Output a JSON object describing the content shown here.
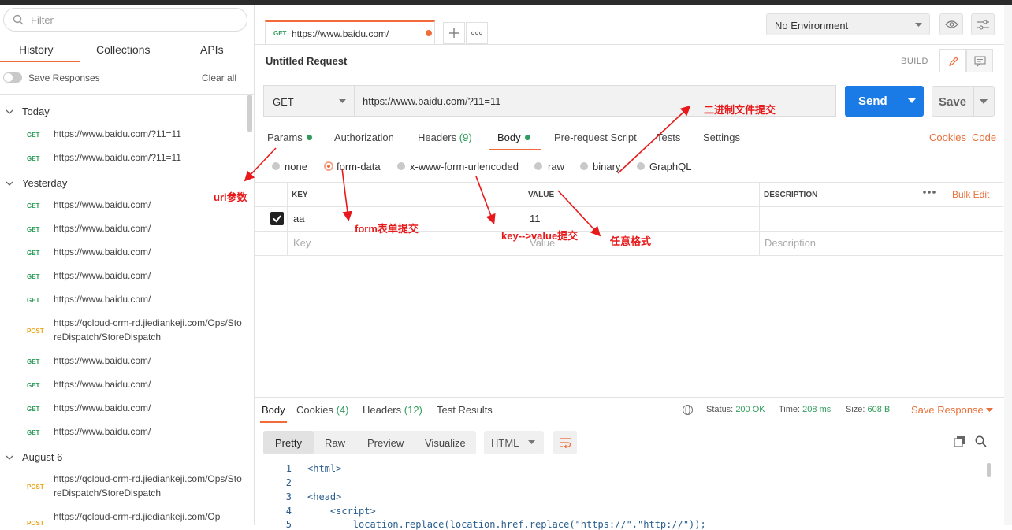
{
  "sidebar": {
    "filter_placeholder": "Filter",
    "tabs": [
      {
        "label": "History"
      },
      {
        "label": "Collections"
      },
      {
        "label": "APIs"
      }
    ],
    "save_responses": "Save Responses",
    "clear_all": "Clear all",
    "groups": [
      {
        "label": "Today",
        "items": [
          {
            "method": "GET",
            "url": "https://www.baidu.com/?11=11"
          },
          {
            "method": "GET",
            "url": "https://www.baidu.com/?11=11"
          }
        ]
      },
      {
        "label": "Yesterday",
        "items": [
          {
            "method": "GET",
            "url": "https://www.baidu.com/"
          },
          {
            "method": "GET",
            "url": "https://www.baidu.com/"
          },
          {
            "method": "GET",
            "url": "https://www.baidu.com/"
          },
          {
            "method": "GET",
            "url": "https://www.baidu.com/"
          },
          {
            "method": "GET",
            "url": "https://www.baidu.com/"
          },
          {
            "method": "POST",
            "url": "https://qcloud-crm-rd.jiediankeji.com/Ops/StoreDispatch/StoreDispatch"
          },
          {
            "method": "GET",
            "url": "https://www.baidu.com/"
          },
          {
            "method": "GET",
            "url": "https://www.baidu.com/"
          },
          {
            "method": "GET",
            "url": "https://www.baidu.com/"
          },
          {
            "method": "GET",
            "url": "https://www.baidu.com/"
          }
        ]
      },
      {
        "label": "August 6",
        "items": [
          {
            "method": "POST",
            "url": "https://qcloud-crm-rd.jiediankeji.com/Ops/StoreDispatch/StoreDispatch"
          },
          {
            "method": "POST",
            "url": "https://qcloud-crm-rd.jiediankeji.com/Op"
          }
        ]
      }
    ]
  },
  "request_tab": {
    "method": "GET",
    "url": "https://www.baidu.com/"
  },
  "environment": "No Environment",
  "request": {
    "title": "Untitled Request",
    "build": "BUILD",
    "method": "GET",
    "url": "https://www.baidu.com/?11=11",
    "send": "Send",
    "save": "Save"
  },
  "req_tabs": {
    "params": "Params",
    "authorization": "Authorization",
    "headers": "Headers",
    "headers_count": "(9)",
    "body": "Body",
    "prerequest": "Pre-request Script",
    "tests": "Tests",
    "settings": "Settings",
    "cookies": "Cookies",
    "code": "Code"
  },
  "body_types": {
    "none": "none",
    "form_data": "form-data",
    "urlencoded": "x-www-form-urlencoded",
    "raw": "raw",
    "binary": "binary",
    "graphql": "GraphQL"
  },
  "kv_table": {
    "headers": {
      "key": "KEY",
      "value": "VALUE",
      "description": "DESCRIPTION"
    },
    "bulk_edit": "Bulk Edit",
    "rows": [
      {
        "key": "aa",
        "value": "11",
        "description": ""
      }
    ],
    "placeholders": {
      "key": "Key",
      "value": "Value",
      "description": "Description"
    }
  },
  "annotations": {
    "url_params": "url参数",
    "form": "form表单提交",
    "kv": "key-->value提交",
    "any": "任意格式",
    "binary": "二进制文件提交"
  },
  "response": {
    "tabs": {
      "body": "Body",
      "cookies": "Cookies",
      "cookies_count": "(4)",
      "headers": "Headers",
      "headers_count": "(12)",
      "test_results": "Test Results"
    },
    "status_label": "Status:",
    "status": "200 OK",
    "time_label": "Time:",
    "time": "208 ms",
    "size_label": "Size:",
    "size": "608 B",
    "save_response": "Save Response",
    "views": {
      "pretty": "Pretty",
      "raw": "Raw",
      "preview": "Preview",
      "visualize": "Visualize"
    },
    "language": "HTML",
    "code_lines": [
      {
        "n": "1",
        "text": "<html>"
      },
      {
        "n": "2",
        "text": ""
      },
      {
        "n": "3",
        "text": "<head>"
      },
      {
        "n": "4",
        "text": "    <script>"
      },
      {
        "n": "5",
        "text": "        location.replace(location.href.replace(\"https://\",\"http://\"));"
      }
    ]
  }
}
